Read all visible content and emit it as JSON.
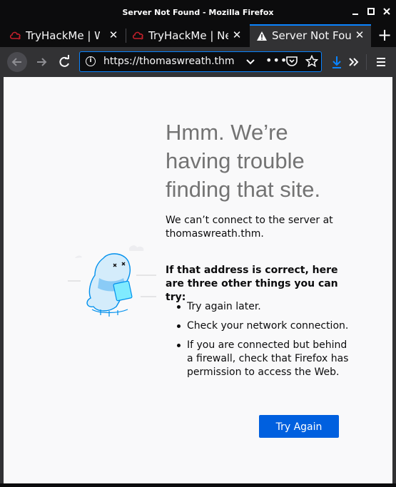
{
  "window": {
    "title": "Server Not Found - Mozilla Firefox",
    "minimize_icon": "minimize-icon",
    "maximize_icon": "maximize-icon",
    "close_icon": "close-icon"
  },
  "tabs": [
    {
      "label": "TryHackMe | Wre",
      "icon": "tryhackme-icon",
      "active": false
    },
    {
      "label": "TryHackMe | Net",
      "icon": "tryhackme-icon",
      "active": false
    },
    {
      "label": "Server Not Found",
      "icon": "warning-icon",
      "active": true
    }
  ],
  "toolbar": {
    "url": "https://thomaswreath.thm"
  },
  "error_page": {
    "heading": "Hmm. We’re having trouble finding that site.",
    "description": "We can’t connect to the server at thomaswreath.thm.",
    "subheading": "If that address is correct, here are three other things you can try:",
    "suggestions": [
      "Try again later.",
      "Check your network connection.",
      "If you are connected but behind a firewall, check that Firefox has permission to access the Web."
    ],
    "try_again_label": "Try Again"
  },
  "colors": {
    "accent": "#0a84ff",
    "button": "#0060df",
    "chrome_dark": "#0c0c0d",
    "chrome_mid": "#323234",
    "page_bg": "#f9f9fa",
    "heading": "#737373",
    "tryhackme_red": "#c3202b"
  }
}
